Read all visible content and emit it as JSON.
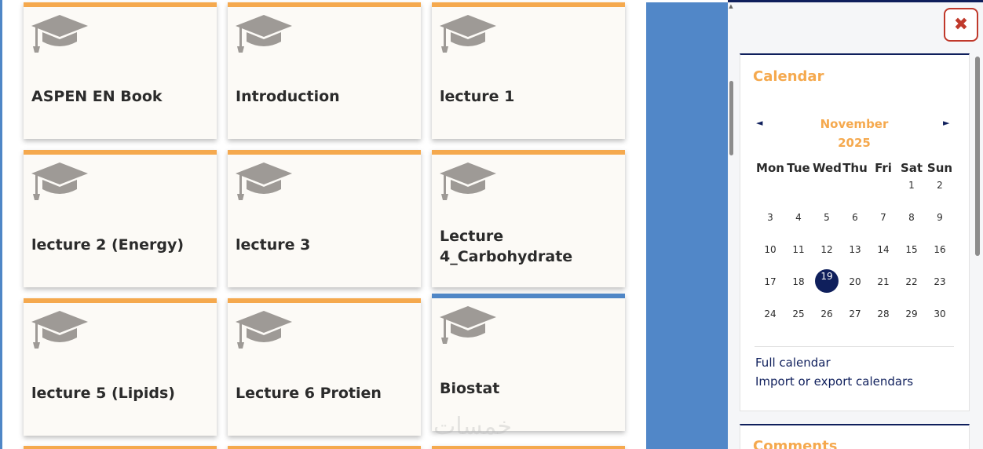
{
  "courses": [
    {
      "title": "ASPEN EN Book",
      "accent": "#f5a94e"
    },
    {
      "title": "Introduction",
      "accent": "#f5a94e"
    },
    {
      "title": "lecture 1",
      "accent": "#f5a94e"
    },
    {
      "title": "lecture 2 (Energy)",
      "accent": "#f5a94e"
    },
    {
      "title": "lecture 3",
      "accent": "#f5a94e"
    },
    {
      "title": "Lecture 4_Carbohydrate",
      "accent": "#f5a94e"
    },
    {
      "title": "lecture 5 (Lipids)",
      "accent": "#f5a94e"
    },
    {
      "title": "Lecture 6 Protien",
      "accent": "#f5a94e"
    },
    {
      "title": "Biostat",
      "accent": "#4f86c6"
    }
  ],
  "course_icon": "graduation-cap-icon",
  "drawer": {
    "close_icon": "close-icon",
    "close_symbol": "✖"
  },
  "calendar": {
    "title": "Calendar",
    "month": "November",
    "year": "2025",
    "prev_symbol": "◄",
    "next_symbol": "►",
    "weekdays": [
      "Mon",
      "Tue",
      "Wed",
      "Thu",
      "Fri",
      "Sat",
      "Sun"
    ],
    "weeks": [
      [
        "",
        "",
        "",
        "",
        "",
        "1",
        "2"
      ],
      [
        "3",
        "4",
        "5",
        "6",
        "7",
        "8",
        "9"
      ],
      [
        "10",
        "11",
        "12",
        "13",
        "14",
        "15",
        "16"
      ],
      [
        "17",
        "18",
        "19",
        "20",
        "21",
        "22",
        "23"
      ],
      [
        "24",
        "25",
        "26",
        "27",
        "28",
        "29",
        "30"
      ]
    ],
    "today": "19",
    "full_calendar_link": "Full calendar",
    "import_export_link": "Import or export calendars"
  },
  "comments": {
    "title": "Comments"
  },
  "watermark": "خمسات",
  "colors": {
    "accent_orange": "#f5a94e",
    "accent_blue": "#4f86c6",
    "navy": "#0f1f5c",
    "close_red": "#c0392b"
  }
}
